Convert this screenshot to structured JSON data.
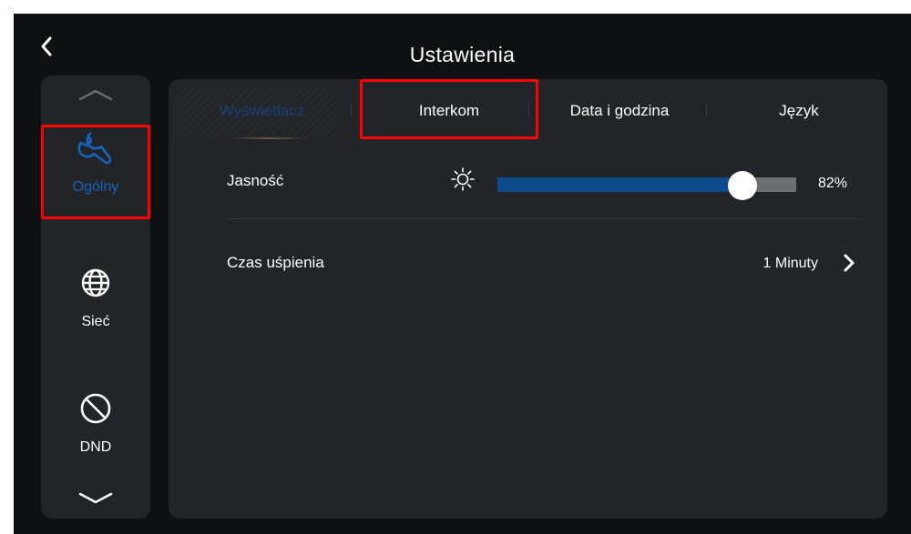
{
  "header": {
    "title": "Ustawienia"
  },
  "sidebar": {
    "items": [
      {
        "label": "Ogólny",
        "icon": "wrench-icon",
        "active": true
      },
      {
        "label": "Sieć",
        "icon": "globe-icon",
        "active": false
      },
      {
        "label": "DND",
        "icon": "do-not-disturb-icon",
        "active": false
      }
    ]
  },
  "tabs": [
    {
      "label": "Wyświetlacz",
      "active": true
    },
    {
      "label": "Interkom",
      "active": false
    },
    {
      "label": "Data i godzina",
      "active": false
    },
    {
      "label": "Język",
      "active": false
    }
  ],
  "settings": {
    "brightness": {
      "label": "Jasność",
      "value": 82,
      "value_text": "82%"
    },
    "sleep_time": {
      "label": "Czas uśpienia",
      "value_text": "1 Minuty"
    }
  },
  "colors": {
    "accent": "#1565c0",
    "slider_fill": "#0e4b8b",
    "highlight": "#ff0000",
    "background": "#0f1012",
    "panel": "#232427"
  }
}
